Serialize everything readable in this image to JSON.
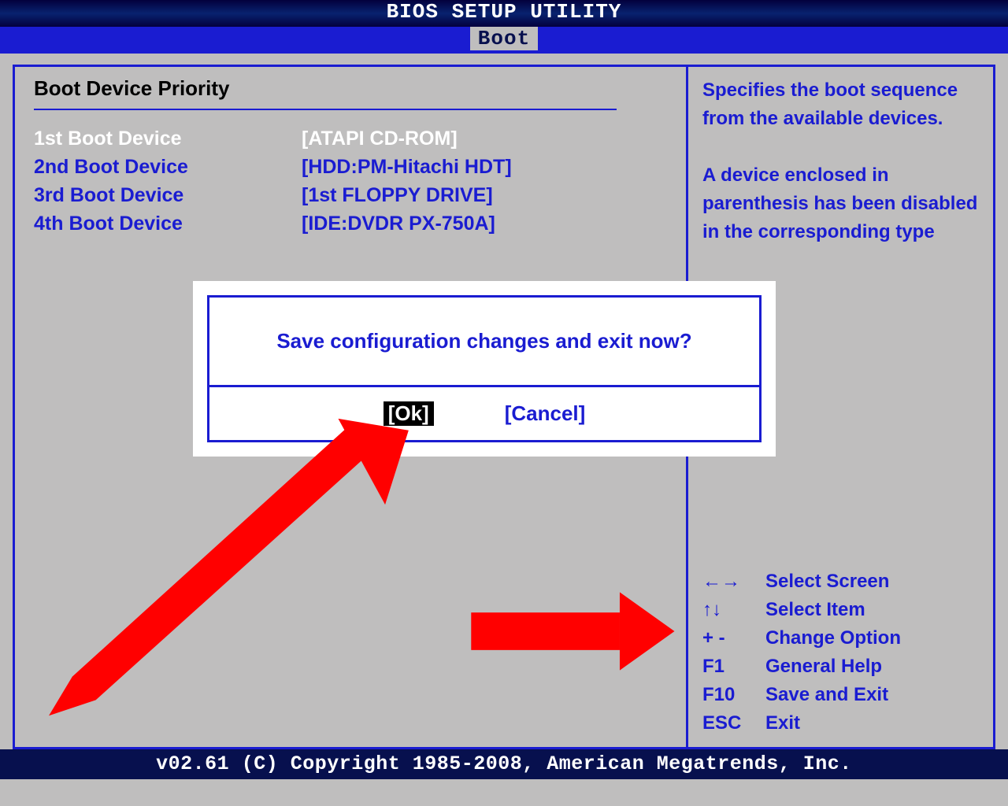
{
  "header": {
    "title": "BIOS SETUP UTILITY"
  },
  "tabs": {
    "active": "Boot"
  },
  "section": {
    "title": "Boot Device Priority"
  },
  "boot": {
    "items": [
      {
        "label": "1st Boot Device",
        "value": "[ATAPI CD-ROM]"
      },
      {
        "label": "2nd Boot Device",
        "value": "[HDD:PM-Hitachi HDT]"
      },
      {
        "label": "3rd Boot Device",
        "value": "[1st FLOPPY DRIVE]"
      },
      {
        "label": "4th Boot Device",
        "value": "[IDE:DVDR PX-750A]"
      }
    ]
  },
  "help": {
    "p1": "Specifies the boot sequence from the available devices.",
    "p2": "A device enclosed in parenthesis has been disabled in the corresponding type"
  },
  "keys": {
    "rows": [
      {
        "k": "←→",
        "d": "Select Screen"
      },
      {
        "k": "↑↓",
        "d": " Select Item"
      },
      {
        "k": "+ -",
        "d": "Change Option"
      },
      {
        "k": "F1",
        "d": "General Help"
      },
      {
        "k": "F10",
        "d": "Save and Exit"
      },
      {
        "k": "ESC",
        "d": "Exit"
      }
    ]
  },
  "dialog": {
    "message": "Save configuration changes and exit now?",
    "ok": "[Ok]",
    "cancel": "[Cancel]"
  },
  "footer": {
    "text": "v02.61 (C) Copyright 1985-2008, American Megatrends, Inc."
  }
}
